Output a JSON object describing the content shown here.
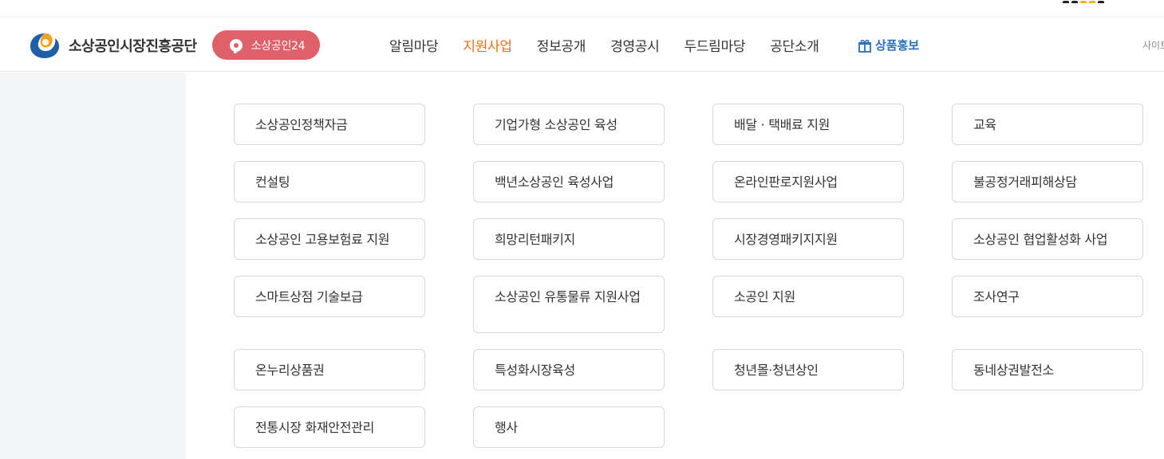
{
  "header": {
    "org_name": "소상공인시장진흥공단",
    "sg24_label": "소상공인24",
    "nav": [
      "알림마당",
      "지원사업",
      "정보공개",
      "경영공시",
      "두드림마당",
      "공단소개"
    ],
    "active_nav": "지원사업",
    "promo_label": "상품홍보",
    "sitemap_label": "사이트"
  },
  "colors": {
    "accent": "#e7711b",
    "sg24_bg": "#e0606a",
    "promo": "#2a6fb8",
    "left_panel": "#f4f5f7",
    "card_border": "#d8d8d8"
  },
  "programs": [
    "소상공인정책자금",
    "기업가형 소상공인 육성",
    "배달 · 택배료 지원",
    "교육",
    "컨설팅",
    "백년소상공인 육성사업",
    "온라인판로지원사업",
    "불공정거래피해상담",
    "소상공인 고용보험료 지원",
    "희망리턴패키지",
    "시장경영패키지지원",
    "소상공인 협업활성화 사업",
    "스마트상점 기술보급",
    "소상공인 유통물류 지원사업",
    "소공인 지원",
    "조사연구",
    "온누리상품권",
    "특성화시장육성",
    "청년몰·청년상인",
    "동네상권발전소",
    "전통시장 화재안전관리",
    "행사"
  ]
}
